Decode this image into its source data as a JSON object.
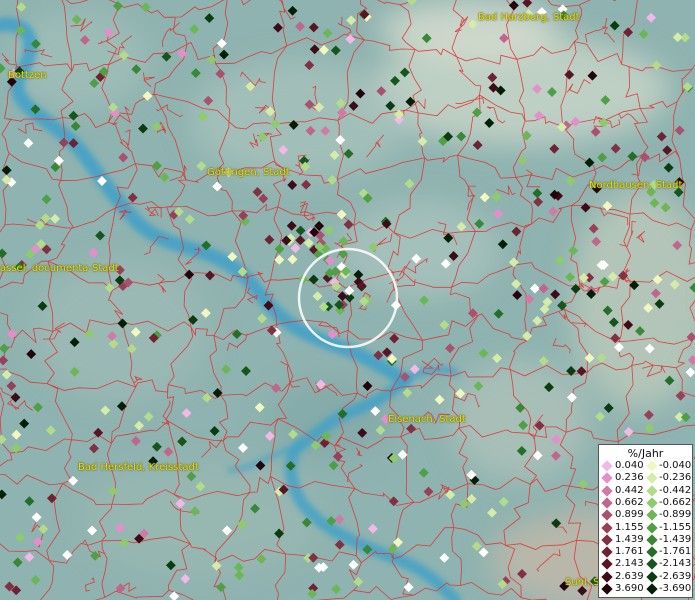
{
  "cities": [
    {
      "name": "Bad Harzburg, Stadt",
      "id": "bad-harzburg"
    },
    {
      "name": "Bottzen",
      "id": "bottzen"
    },
    {
      "name": "Göttingen, Stadt",
      "id": "goettingen"
    },
    {
      "name": "Nordhausen, Stadt",
      "id": "nordhausen"
    },
    {
      "name": "assel, documenta-Stadt",
      "id": "kassel"
    },
    {
      "name": "Eisenach, Stadt",
      "id": "eisenach"
    },
    {
      "name": "Bad Hersfeld, Kreisstadt",
      "id": "bad-hersfeld"
    },
    {
      "name": "Suhl, S",
      "id": "suhl"
    }
  ],
  "legend": {
    "title": "%/Jahr",
    "positive": [
      {
        "value": "0.040",
        "color": "#f2b8e6"
      },
      {
        "value": "0.236",
        "color": "#e48fcc"
      },
      {
        "value": "0.442",
        "color": "#d27aa6"
      },
      {
        "value": "0.662",
        "color": "#c0668c"
      },
      {
        "value": "0.899",
        "color": "#a9516f"
      },
      {
        "value": "1.155",
        "color": "#974058"
      },
      {
        "value": "1.439",
        "color": "#823043"
      },
      {
        "value": "1.761",
        "color": "#6e2232"
      },
      {
        "value": "2.143",
        "color": "#581624"
      },
      {
        "value": "2.639",
        "color": "#3e0c18"
      },
      {
        "value": "3.690",
        "color": "#22040c"
      }
    ],
    "negative": [
      {
        "value": "-0.040",
        "color": "#f0f8c0"
      },
      {
        "value": "-0.236",
        "color": "#d4eca8"
      },
      {
        "value": "-0.442",
        "color": "#b2dc8a"
      },
      {
        "value": "-0.662",
        "color": "#8ecb6c"
      },
      {
        "value": "-0.899",
        "color": "#6cb656"
      },
      {
        "value": "-1.155",
        "color": "#4f9f44"
      },
      {
        "value": "-1.439",
        "color": "#388836"
      },
      {
        "value": "-1.761",
        "color": "#246f28"
      },
      {
        "value": "-2.143",
        "color": "#16561c"
      },
      {
        "value": "-2.639",
        "color": "#0a3c10"
      },
      {
        "value": "-3.690",
        "color": "#032006"
      }
    ]
  },
  "colors": {
    "terrain": "#8fb3b0",
    "water": "#3fa0c8",
    "borders": "#e03030",
    "city_label": "#e8e000",
    "selection_circle": "#ffffff"
  }
}
